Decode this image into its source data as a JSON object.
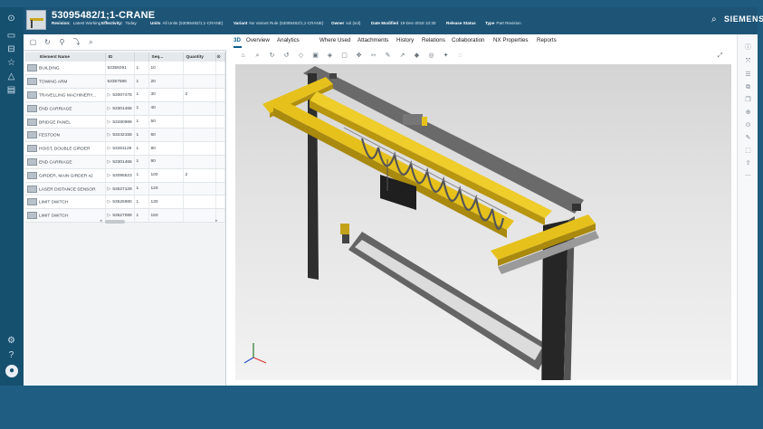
{
  "header": {
    "title": "53095482/1;1-CRANE",
    "meta_row1": [
      {
        "label": "Revision:",
        "value": "Latest Working"
      },
      {
        "label": "Effectivity:",
        "value": "Today"
      }
    ],
    "meta_row2": [
      {
        "label": "Units",
        "value": "All Units  (53095482/1;1-CRANE)"
      },
      {
        "label": "Variant",
        "value": "No Variant Rule  (53095482/1;1-CRANE)"
      },
      {
        "label": "Owner",
        "value": "sol (sol)"
      },
      {
        "label": "Date Modified",
        "value": "19-Dec-2018 10:30"
      },
      {
        "label": "Release Status",
        "value": ""
      },
      {
        "label": "Type",
        "value": "Part Revision"
      }
    ],
    "brand": "SIEMENS"
  },
  "grid": {
    "columns": [
      "Element Name",
      "ID",
      "Rev",
      "Seq...",
      "Quantity"
    ],
    "rows": [
      {
        "name": "BUILDING",
        "id": "53359291",
        "rev": "1",
        "seq": "10",
        "qty": "",
        "arrow": false
      },
      {
        "name": "TOWING ARM",
        "id": "53357586",
        "rev": "1",
        "seq": "20",
        "qty": "",
        "arrow": false
      },
      {
        "name": "TRAVELLING MACHINERY...",
        "id": "53007478",
        "rev": "1",
        "seq": "30",
        "qty": "2",
        "arrow": true
      },
      {
        "name": "END CARRIAGE",
        "id": "53301466",
        "rev": "1",
        "seq": "40",
        "qty": "",
        "arrow": true
      },
      {
        "name": "BRIDGE PANEL",
        "id": "53280989",
        "rev": "1",
        "seq": "50",
        "qty": "",
        "arrow": true
      },
      {
        "name": "FESTOON",
        "id": "53242155",
        "rev": "1",
        "seq": "60",
        "qty": "",
        "arrow": true
      },
      {
        "name": "HOIST, DOUBLE GIRDER",
        "id": "53261129",
        "rev": "1",
        "seq": "80",
        "qty": "",
        "arrow": true
      },
      {
        "name": "END CARRIAGE",
        "id": "53301466",
        "rev": "1",
        "seq": "90",
        "qty": "",
        "arrow": true
      },
      {
        "name": "GIRDER, MAIN GIRDER x2",
        "id": "53095523",
        "rev": "1",
        "seq": "100",
        "qty": "2",
        "arrow": true
      },
      {
        "name": "LASER DISTANCE SENSOR",
        "id": "53527129",
        "rev": "1",
        "seq": "120",
        "qty": "",
        "arrow": true
      },
      {
        "name": "LIMIT SWITCH",
        "id": "53526980",
        "rev": "1",
        "seq": "130",
        "qty": "",
        "arrow": true
      },
      {
        "name": "LIMIT SWITCH",
        "id": "53527089",
        "rev": "1",
        "seq": "150",
        "qty": "",
        "arrow": true
      }
    ]
  },
  "tabs": [
    "3D",
    "Overview",
    "Analytics",
    "Where Used",
    "Attachments",
    "History",
    "Relations",
    "Collaboration",
    "NX Properties",
    "Reports"
  ],
  "active_tab": "3D",
  "colors": {
    "frame": "#1f5b7e",
    "accent": "#0b5e8a",
    "crane_yellow": "#e6c11c",
    "steel_dark": "#3b3b3b"
  }
}
